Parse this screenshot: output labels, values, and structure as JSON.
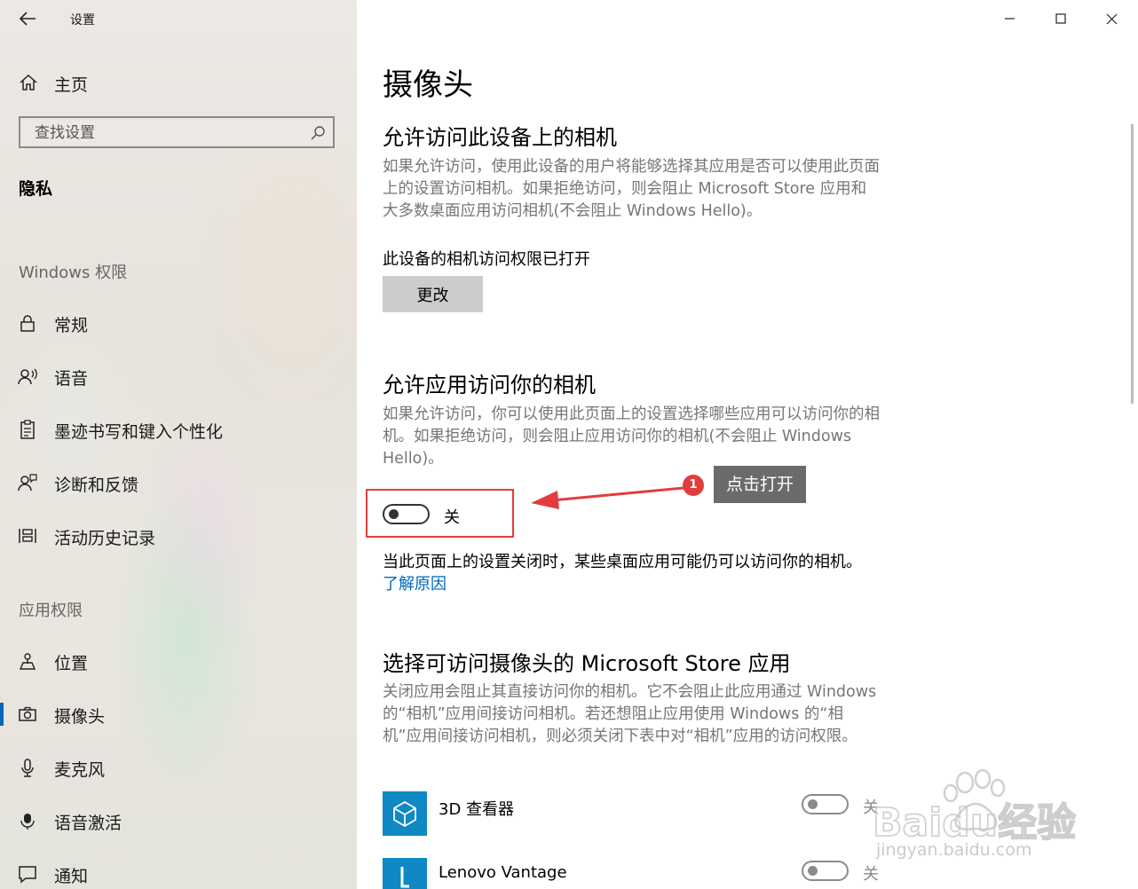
{
  "app": {
    "title": "设置"
  },
  "sidebar": {
    "home_label": "主页",
    "search_placeholder": "查找设置",
    "category": "隐私",
    "windows_group": "Windows 权限",
    "windows_items": [
      {
        "label": "常规",
        "icon": "lock-icon"
      },
      {
        "label": "语音",
        "icon": "speech-icon"
      },
      {
        "label": "墨迹书写和键入个性化",
        "icon": "clipboard-icon"
      },
      {
        "label": "诊断和反馈",
        "icon": "feedback-icon"
      },
      {
        "label": "活动历史记录",
        "icon": "timeline-icon"
      }
    ],
    "app_group": "应用权限",
    "app_items": [
      {
        "label": "位置",
        "icon": "location-icon"
      },
      {
        "label": "摄像头",
        "icon": "camera-icon",
        "active": true
      },
      {
        "label": "麦克风",
        "icon": "microphone-icon"
      },
      {
        "label": "语音激活",
        "icon": "voice-activation-icon"
      },
      {
        "label": "通知",
        "icon": "notification-icon"
      }
    ]
  },
  "main": {
    "title": "摄像头",
    "device_section": {
      "heading": "允许访问此设备上的相机",
      "description": "如果允许访问，使用此设备的用户将能够选择其应用是否可以使用此页面上的设置访问相机。如果拒绝访问，则会阻止 Microsoft Store 应用和大多数桌面应用访问相机(不会阻止 Windows Hello)。",
      "status": "此设备的相机访问权限已打开",
      "change_button": "更改"
    },
    "apps_section": {
      "heading": "允许应用访问你的相机",
      "description": "如果允许访问，你可以使用此页面上的设置选择哪些应用可以访问你的相机。如果拒绝访问，则会阻止应用访问你的相机(不会阻止 Windows Hello)。",
      "toggle_label": "关",
      "toggle_on": false,
      "note": "当此页面上的设置关闭时，某些桌面应用可能仍可以访问你的相机。",
      "note_link": "了解原因"
    },
    "store_section": {
      "heading": "选择可访问摄像头的 Microsoft Store 应用",
      "description": "关闭应用会阻止其直接访问你的相机。它不会阻止此应用通过 Windows 的“相机”应用间接访问相机。若还想阻止应用使用 Windows 的“相机”应用间接访问相机，则必须关闭下表中对“相机”应用的访问权限。",
      "apps": [
        {
          "name": "3D 查看器",
          "toggle_label": "关",
          "on": false,
          "icon": "cube-icon"
        },
        {
          "name": "Lenovo Vantage",
          "toggle_label": "关",
          "on": false,
          "icon": "lenovo-vantage-icon"
        }
      ]
    }
  },
  "annotation": {
    "badge": "1",
    "text": "点击打开"
  },
  "watermark": {
    "brand": "Baidu经验",
    "url": "jingyan.baidu.com"
  },
  "colors": {
    "accent": "#0067b8",
    "annotation": "#e23d3d",
    "tile": "#0f88c4"
  }
}
